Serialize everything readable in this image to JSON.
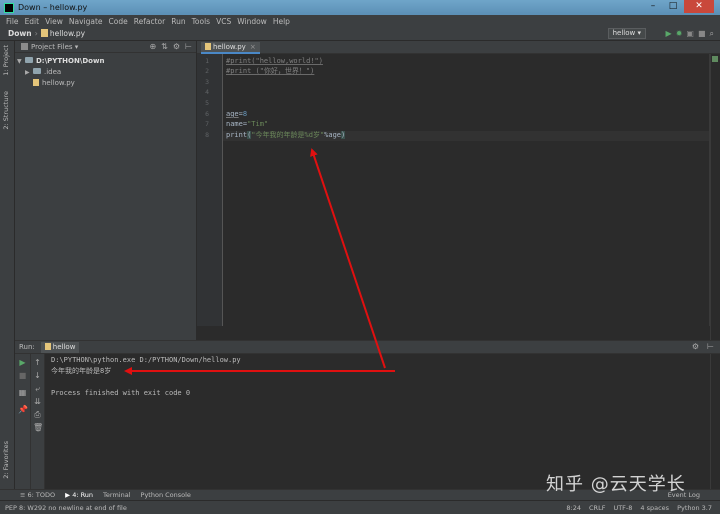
{
  "window": {
    "title": "Down – hellow.py"
  },
  "menu": [
    "File",
    "Edit",
    "View",
    "Navigate",
    "Code",
    "Refactor",
    "Run",
    "Tools",
    "VCS",
    "Window",
    "Help"
  ],
  "breadcrumb": {
    "project": "Down",
    "file": "hellow.py"
  },
  "toolbar": {
    "run_config": "hellow ▾"
  },
  "side_tabs": {
    "project": "1: Project",
    "structure": "2: Structure",
    "favorites": "2: Favorites"
  },
  "project_panel": {
    "title": "Project Files",
    "tree": [
      {
        "label": "D:\\PYTHON\\Down",
        "kind": "root"
      },
      {
        "label": ".idea",
        "kind": "folder"
      },
      {
        "label": "hellow.py",
        "kind": "file"
      }
    ]
  },
  "editor": {
    "tab": "hellow.py",
    "lines": [
      {
        "n": "1",
        "text": "#print(\"hellow,world!\")",
        "style": "cmt"
      },
      {
        "n": "2",
        "text": "#print (\"你好，世界！\")",
        "style": "cmt"
      },
      {
        "n": "3",
        "text": "",
        "style": "kw"
      },
      {
        "n": "4",
        "text": "",
        "style": "kw"
      },
      {
        "n": "5",
        "text": "",
        "style": "kw"
      },
      {
        "n": "6",
        "text": "age=8",
        "style": "age"
      },
      {
        "n": "7",
        "text": "name=\"Tim\"",
        "style": "name"
      },
      {
        "n": "8",
        "text": "print(\"今年我的年龄是%d岁\"%age)",
        "style": "print"
      }
    ]
  },
  "run_panel": {
    "label": "Run:",
    "tab": "hellow",
    "output": [
      "D:\\PYTHON\\python.exe D:/PYTHON/Down/hellow.py",
      "今年我的年龄是8岁",
      "",
      "Process finished with exit code 0"
    ]
  },
  "bottom_tabs": {
    "todo": "≡ 6: TODO",
    "run": "▶ 4: Run",
    "terminal": "Terminal",
    "console": "Python Console",
    "event_log": "Event Log"
  },
  "status": {
    "left": "PEP 8: W292 no newline at end of file",
    "position": "8:24",
    "line_sep": "CRLF",
    "encoding": "UTF-8",
    "indent": "4 spaces",
    "interpreter": "Python 3.7"
  },
  "watermark": "知乎 @云天学长",
  "colors": {
    "annotation_arrow": "#e01010",
    "accent": "#4a88c7"
  }
}
